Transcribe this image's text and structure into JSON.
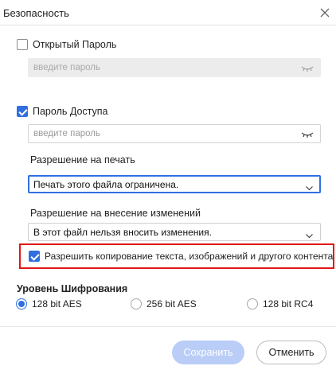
{
  "dialog": {
    "title": "Безопасность"
  },
  "open_password": {
    "label": "Открытый Пароль",
    "checked": false,
    "placeholder": "введите пароль",
    "disabled": true
  },
  "access_password": {
    "label": "Пароль Доступа",
    "checked": true,
    "placeholder": "введите пароль"
  },
  "print_permission": {
    "label": "Разрешение на печать",
    "value": "Печать этого файла ограничена."
  },
  "edit_permission": {
    "label": "Разрешение на внесение изменений",
    "value": "В этот файл нельзя вносить изменения."
  },
  "copy_permission": {
    "label": "Разрешить копирование текста, изображений и другого контента",
    "checked": true
  },
  "encryption": {
    "title": "Уровень Шифрования",
    "options": [
      {
        "label": "128 bit AES",
        "selected": true
      },
      {
        "label": "256 bit AES",
        "selected": false
      },
      {
        "label": "128 bit RC4",
        "selected": false
      }
    ]
  },
  "buttons": {
    "save": "Сохранить",
    "cancel": "Отменить"
  },
  "colors": {
    "accent": "#2f6fe0",
    "highlight_border": "#e01717",
    "save_disabled_bg": "#b9cdf7"
  }
}
